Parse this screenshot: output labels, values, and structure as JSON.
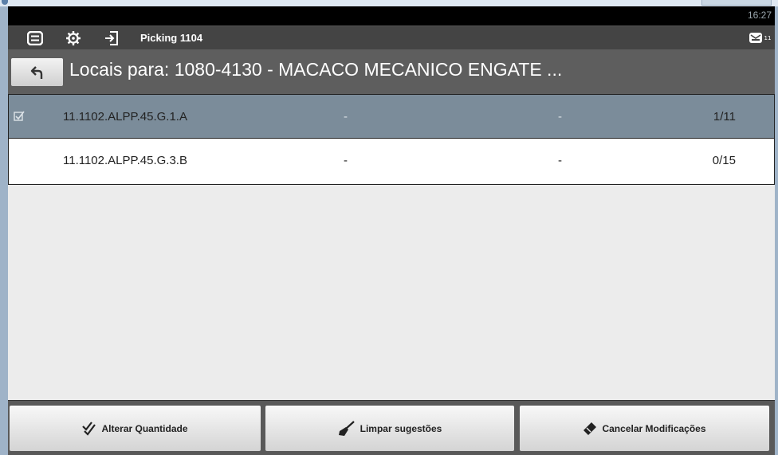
{
  "statusbar": {
    "clock": "16:27"
  },
  "actionbar": {
    "icons": [
      "list-icon",
      "gear-icon",
      "login-icon"
    ],
    "title": "Picking 1104",
    "message_count": "11"
  },
  "header": {
    "title": "Locais para: 1080-4130 - MACACO MECANICO ENGATE ..."
  },
  "rows": [
    {
      "location": "11.1102.ALPP.45.G.1.A",
      "col2": "-",
      "col3": "-",
      "qty": "1/11",
      "selected": true
    },
    {
      "location": "11.1102.ALPP.45.G.3.B",
      "col2": "-",
      "col3": "-",
      "qty": "0/15",
      "selected": false
    }
  ],
  "buttons": {
    "alterar": "Alterar Quantidade",
    "limpar": "Limpar sugestões",
    "cancelar": "Cancelar Modificações"
  },
  "colors": {
    "selected_row": "#7b8c9a",
    "header": "#5e5e5e",
    "actionbar": "#444444",
    "bottombar": "#595959"
  }
}
